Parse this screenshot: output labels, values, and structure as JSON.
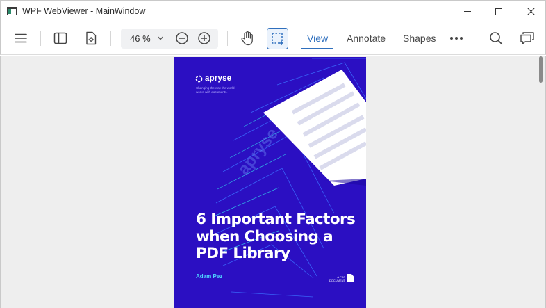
{
  "window": {
    "title": "WPF WebViewer - MainWindow"
  },
  "toolbar": {
    "zoom_value": "46 %",
    "tabs": [
      {
        "label": "View",
        "active": true
      },
      {
        "label": "Annotate",
        "active": false
      },
      {
        "label": "Shapes",
        "active": false
      }
    ],
    "icons": {
      "menu": "hamburger-icon",
      "left_panel": "panel-toggle-icon",
      "settings": "document-settings-icon",
      "zoom_dropdown": "chevron-down-icon",
      "zoom_out": "zoom-out-icon",
      "zoom_in": "zoom-in-icon",
      "pan": "hand-pan-icon",
      "select": "marquee-select-icon",
      "more": "more-horizontal-icon",
      "search": "search-icon",
      "comments": "comments-icon"
    },
    "accent_color": "#2f6fbd"
  },
  "document": {
    "brand": "apryse",
    "tagline": "Changing the way the world works with documents.",
    "title_lines": [
      "6 Important Factors",
      "when Choosing a",
      "PDF Library"
    ],
    "author": "Adam Pez",
    "doc_label": "A PDF DOCUMENT",
    "watermark": "apryse",
    "background_color": "#2b0fc2",
    "author_color": "#4fd3ff"
  }
}
